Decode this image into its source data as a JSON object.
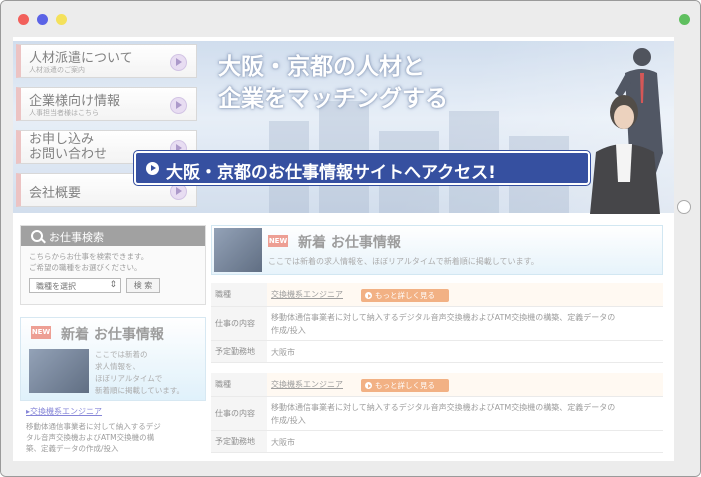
{
  "window": {
    "traffic_lights": {
      "close": "#f2605b",
      "minimize": "#5b63e6",
      "zoom": "#f4e15b"
    },
    "status_dot": "#5fbf5f"
  },
  "nav": {
    "items": [
      {
        "label": "人材派遣について",
        "sub": "人材派遣のご案内"
      },
      {
        "label": "企業様向け情報",
        "sub": "人事担当者様はこちら"
      },
      {
        "label": "お申し込み\nお問い合わせ",
        "sub": ""
      },
      {
        "label": "会社概要",
        "sub": ""
      }
    ]
  },
  "banner": {
    "headline_line1": "大阪・京都の人材と",
    "headline_line2": "企業をマッチングする",
    "cta_label": "大阪・京都のお仕事情報サイトへアクセス!"
  },
  "search": {
    "title": "お仕事検索",
    "desc_line1": "こちらからお仕事を検索できます。",
    "desc_line2": "ご希望の職種をお選びください。",
    "select_value": "職種を選択",
    "button_label": "検 索"
  },
  "side_new": {
    "tag": "NEW",
    "title": "新着 お仕事情報",
    "desc_lines": [
      "ここでは新着の",
      "求人情報を、",
      "ほぼリアルタイムで",
      "新着順に掲載しています。"
    ],
    "job_title": "交換機系エンジニア",
    "job_desc_lines": [
      "移動体通信事業者に対して納入するデジ",
      "タル音声交換機およびATM交換機の構",
      "築、定義データの作成/投入"
    ]
  },
  "main_new": {
    "tag": "NEW",
    "title": "新着 お仕事情報",
    "subtitle": "ここでは新着の求人情報を、ほぼリアルタイムで新着順に掲載しています。",
    "listings": [
      {
        "k_type": "職種",
        "job_title": "交換機系エンジニア",
        "more_label": "もっと詳しく見る",
        "k_content": "仕事の内容",
        "content_line1": "移動体通信事業者に対して納入するデジタル音声交換機およびATM交換機の構築、定義データの",
        "content_line2": "作成/投入",
        "k_location": "予定勤務地",
        "location": "大阪市"
      },
      {
        "k_type": "職種",
        "job_title": "交換機系エンジニア",
        "more_label": "もっと詳しく見る",
        "k_content": "仕事の内容",
        "content_line1": "移動体通信事業者に対して納入するデジタル音声交換機およびATM交換機の構築、定義データの",
        "content_line2": "作成/投入",
        "k_location": "予定勤務地",
        "location": "大阪市"
      }
    ]
  }
}
